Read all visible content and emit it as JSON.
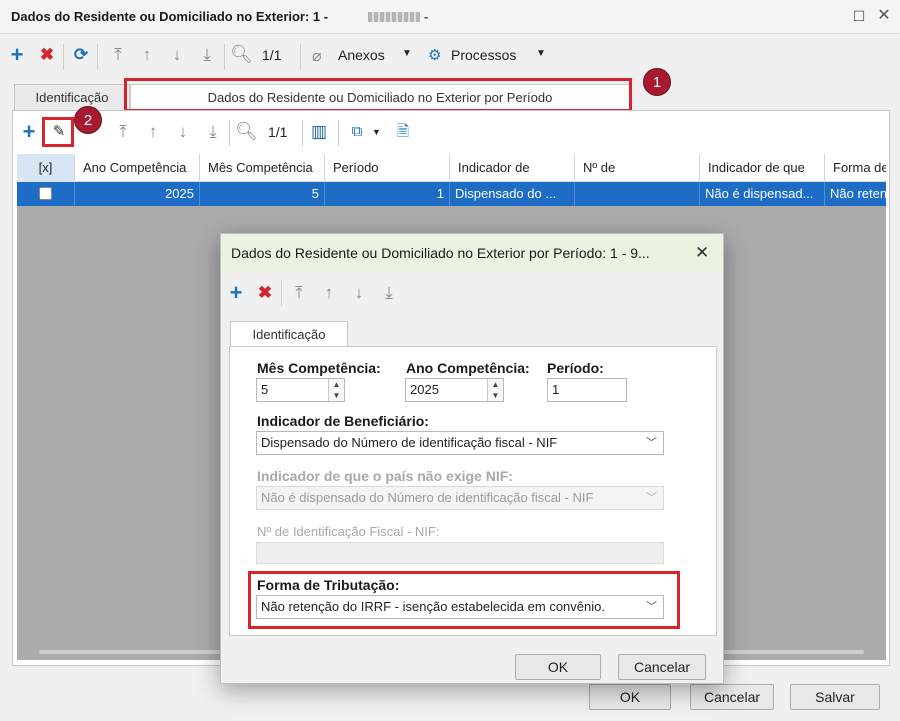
{
  "main_window": {
    "title": "Dados do Residente ou Domiciliado no Exterior: 1 -",
    "toolbar": {
      "anexos_label": "Anexos",
      "processos_label": "Processos",
      "page_counter": "1/1"
    },
    "tabs": [
      {
        "label": "Identificação"
      },
      {
        "label": "Dados do Residente ou Domiciliado no Exterior por Período"
      }
    ],
    "inner_toolbar": {
      "page_counter": "1/1"
    },
    "grid": {
      "columns": [
        "[x]",
        "Ano Competência",
        "Mês Competência",
        "Período",
        "Indicador de",
        "Nº de",
        "Indicador de que",
        "Forma de"
      ],
      "rows": [
        {
          "ano": "2025",
          "mes": "5",
          "periodo": "1",
          "indicador": "Dispensado do ...",
          "numero": "",
          "indicador_que": "Não é dispensad...",
          "forma": "Não reten"
        }
      ]
    },
    "buttons": {
      "ok": "OK",
      "cancel": "Cancelar",
      "save": "Salvar"
    }
  },
  "badges": {
    "one": "1",
    "two": "2"
  },
  "dialog": {
    "title": "Dados do Residente ou Domiciliado no Exterior por Período: 1 - 9...",
    "tab_label": "Identificação",
    "fields": {
      "mes_label": "Mês Competência:",
      "mes_value": "5",
      "ano_label": "Ano Competência:",
      "ano_value": "2025",
      "periodo_label": "Período:",
      "periodo_value": "1",
      "beneficiario_label": "Indicador de Beneficiário:",
      "beneficiario_value": "Dispensado do Número de identificação fiscal - NIF",
      "nif_exige_label": "Indicador de que o país não exige NIF:",
      "nif_exige_value": "Não é dispensado do Número de identificação fiscal - NIF",
      "nif_label": "Nº de Identificação Fiscal - NIF:",
      "nif_value": "",
      "tributacao_label": "Forma de Tributação:",
      "tributacao_value": "Não retenção do IRRF - isenção estabelecida em convênio."
    },
    "buttons": {
      "ok": "OK",
      "cancel": "Cancelar"
    }
  },
  "colors": {
    "highlight": "#d9232d",
    "badge": "#a6192e",
    "selected_row": "#1d6dc7",
    "dialog_title_bg": "#eaf3e2"
  }
}
